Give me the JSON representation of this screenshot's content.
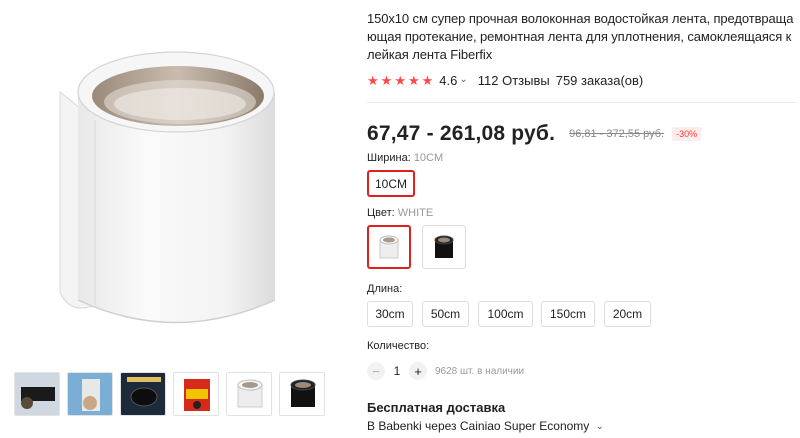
{
  "product": {
    "title": "150x10 см супер прочная волоконная водостойкая лента, предотвращающая протекание, ремонтная лента для уплотнения, самоклеящаяся клейкая лента Fiberfix",
    "rating": "4.6",
    "reviews": "112 Отзывы",
    "orders": "759 заказа(ов)",
    "price": "67,47 - 261,08 руб.",
    "old_price": "96,81 - 372,55 руб.",
    "discount": "-30%"
  },
  "options": {
    "width_label": "Ширина:",
    "width_selected": "10CM",
    "width_values": [
      "10CM"
    ],
    "color_label": "Цвет:",
    "color_selected": "WHITE",
    "colors": [
      "white-tape-icon",
      "black-tape-icon"
    ],
    "length_label": "Длина:",
    "length_values": [
      "30cm",
      "50cm",
      "100cm",
      "150cm",
      "20cm"
    ]
  },
  "quantity": {
    "label": "Количество:",
    "value": "1",
    "minus": "−",
    "plus": "+",
    "stock": "9628 шт. в наличии"
  },
  "shipping": {
    "title": "Бесплатная доставка",
    "detail": "В Babenki через Cainiao Super Economy"
  },
  "gallery": {
    "thumbnails": [
      "thumb-1-black-tape-repair",
      "thumb-2-pipe-repair",
      "thumb-3-black-roll-box",
      "thumb-4-package",
      "thumb-5-white-roll",
      "thumb-6-black-roll"
    ]
  },
  "colors": {
    "accent": "#ff4747",
    "active_border": "#e02020",
    "discount_bg": "#ffecec"
  }
}
